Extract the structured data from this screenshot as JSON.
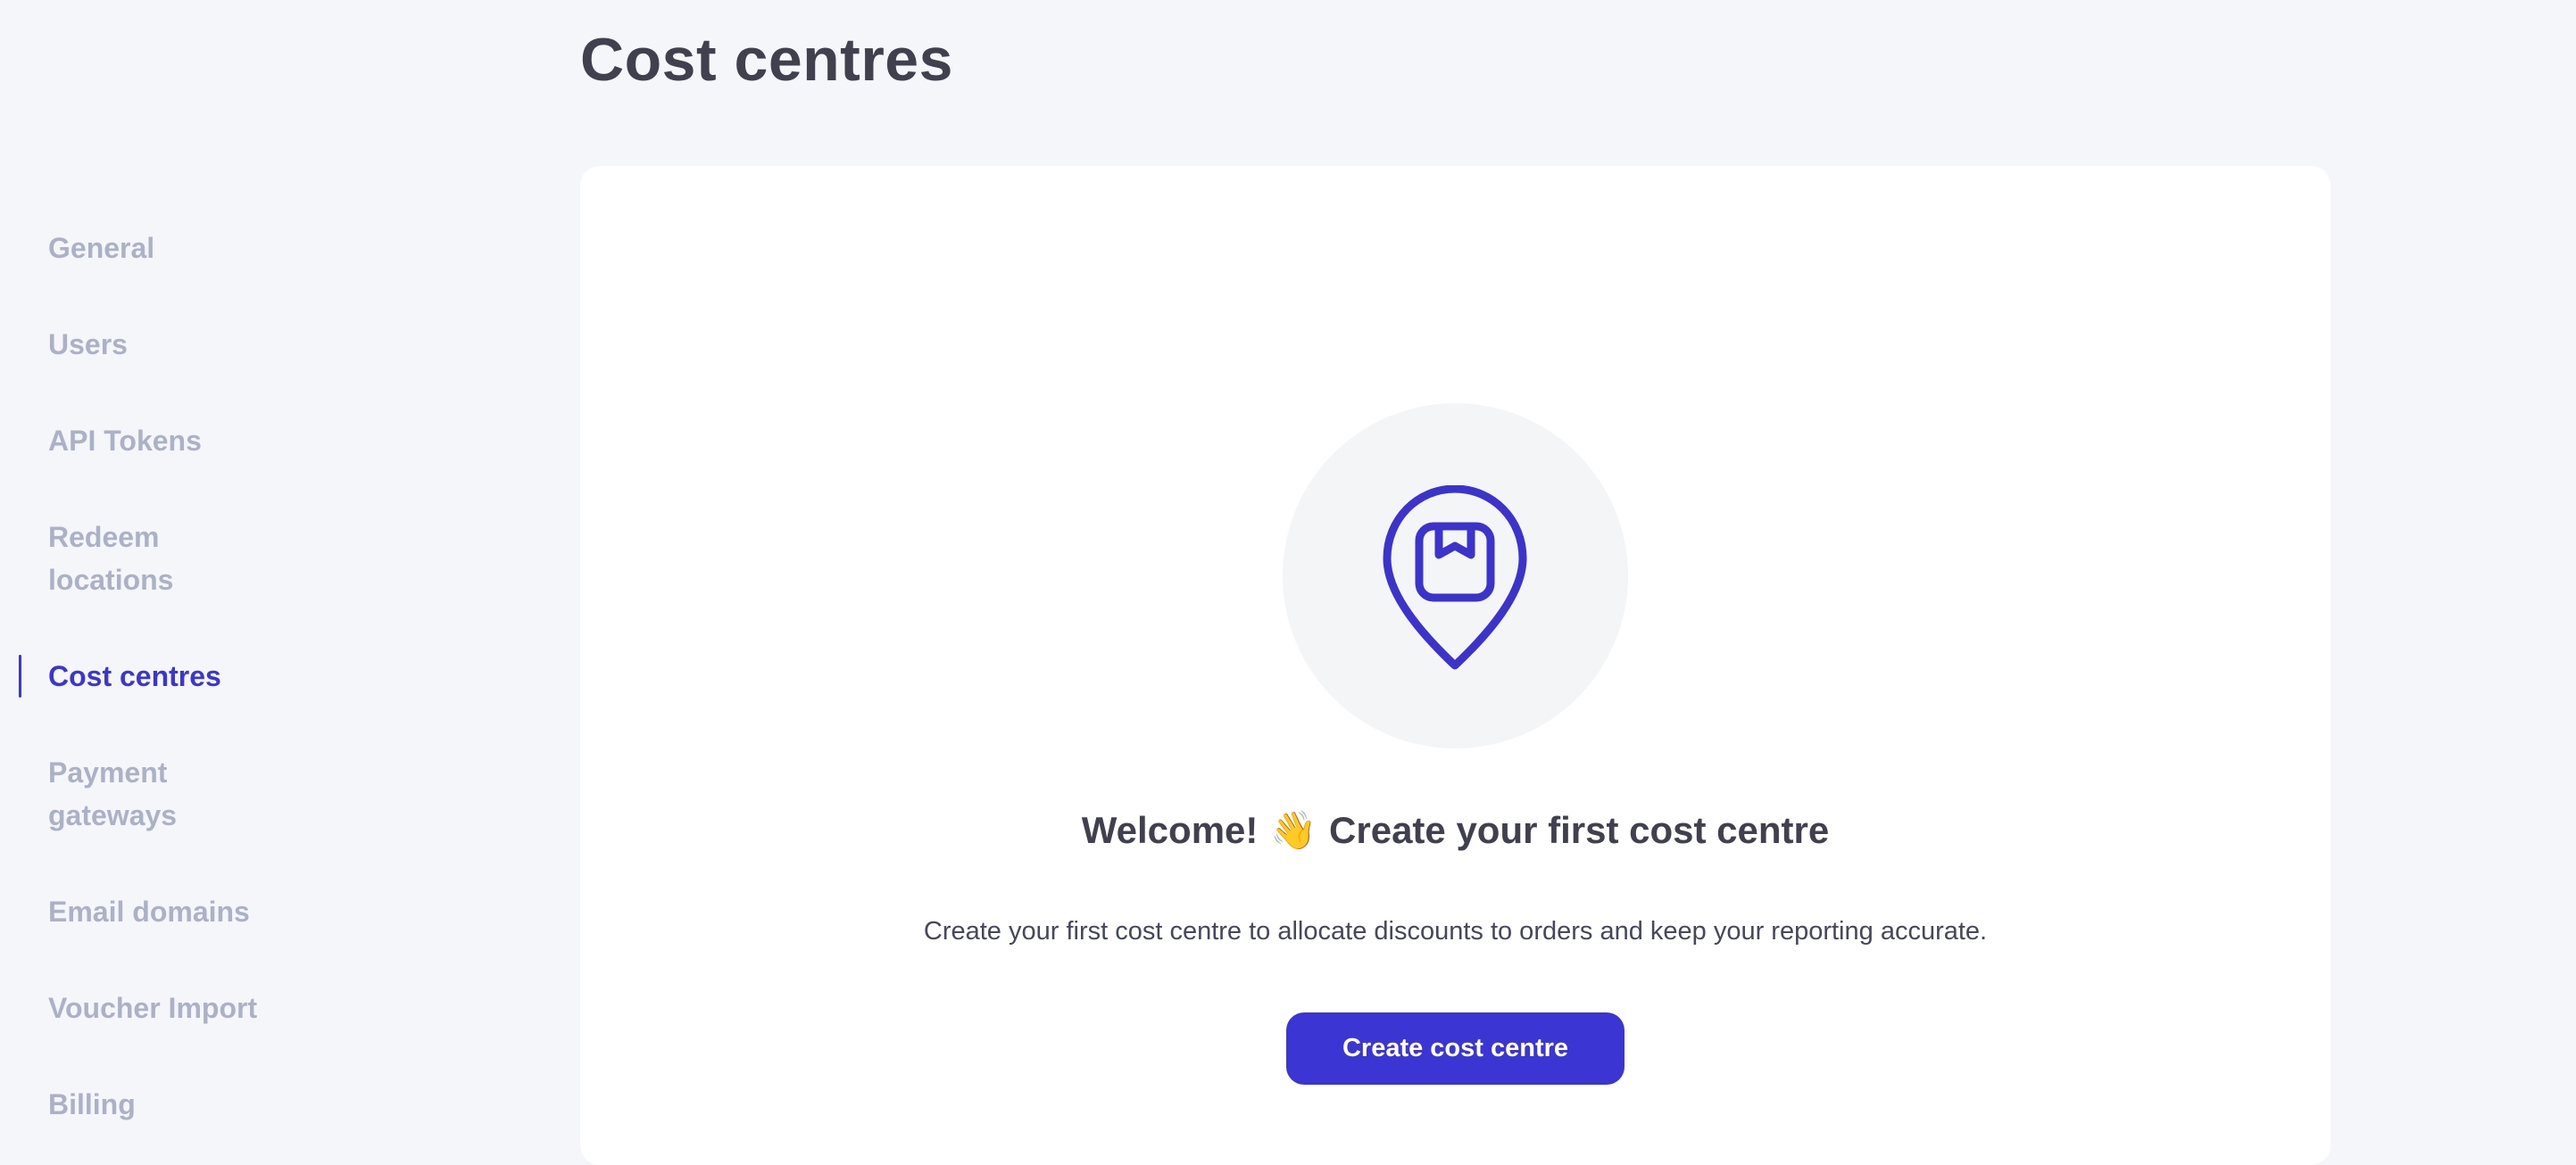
{
  "page": {
    "title": "Cost centres"
  },
  "sidebar": {
    "items": [
      {
        "label": "General",
        "active": false
      },
      {
        "label": "Users",
        "active": false
      },
      {
        "label": "API Tokens",
        "active": false
      },
      {
        "label": "Redeem locations",
        "active": false
      },
      {
        "label": "Cost centres",
        "active": true
      },
      {
        "label": "Payment gateways",
        "active": false
      },
      {
        "label": "Email domains",
        "active": false
      },
      {
        "label": "Voucher Import",
        "active": false
      },
      {
        "label": "Billing",
        "active": false
      }
    ]
  },
  "empty_state": {
    "icon": "location-pin-package-icon",
    "title_before": "Welcome!",
    "wave_emoji": "👋",
    "title_after": "Create your first cost centre",
    "description": "Create your first cost centre to allocate discounts to orders and keep your reporting accurate.",
    "button_label": "Create cost centre"
  },
  "colors": {
    "accent": "#3b36d3",
    "background": "#f5f6fa",
    "card": "#ffffff",
    "sidebar_inactive": "#acb2c6",
    "heading": "#41404f"
  }
}
